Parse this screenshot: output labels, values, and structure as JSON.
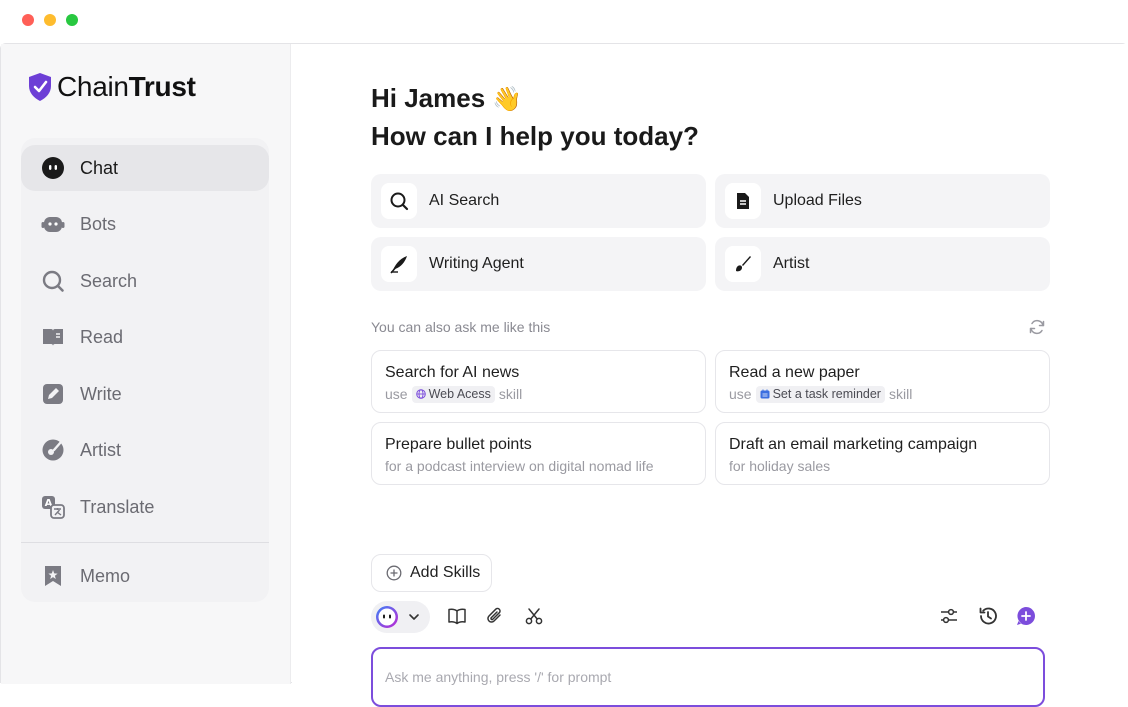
{
  "brand": {
    "part1": "Chain",
    "part2": "Trust"
  },
  "sidebar": {
    "items": [
      {
        "label": "Chat",
        "icon": "chat-bot-icon",
        "active": true
      },
      {
        "label": "Bots",
        "icon": "bots-icon"
      },
      {
        "label": "Search",
        "icon": "search-icon"
      },
      {
        "label": "Read",
        "icon": "read-icon"
      },
      {
        "label": "Write",
        "icon": "write-icon"
      },
      {
        "label": "Artist",
        "icon": "artist-icon"
      },
      {
        "label": "Translate",
        "icon": "translate-icon"
      }
    ],
    "memo": {
      "label": "Memo",
      "icon": "memo-icon"
    }
  },
  "main": {
    "greeting_line1": "Hi James",
    "greeting_emoji": "👋",
    "greeting_line2": "How can I help you today?",
    "actions": [
      {
        "label": "AI Search",
        "icon": "search-icon"
      },
      {
        "label": "Upload Files",
        "icon": "file-icon"
      },
      {
        "label": "Writing Agent",
        "icon": "quill-icon"
      },
      {
        "label": "Artist",
        "icon": "brush-icon"
      }
    ],
    "hint": "You can also ask me like this",
    "suggestions": [
      {
        "title": "Search for AI news",
        "pre": "use",
        "chip": "Web Acess",
        "post": "skill",
        "chip_icon": "globe-icon"
      },
      {
        "title": "Read a new paper",
        "pre": "use",
        "chip": "Set a task reminder",
        "post": "skill",
        "chip_icon": "calendar-icon"
      },
      {
        "title": "Prepare bullet points",
        "sub": "for a podcast interview on digital nomad life"
      },
      {
        "title": "Draft an email marketing campaign",
        "sub": "for holiday sales"
      }
    ],
    "add_skills": "Add Skills",
    "input_placeholder": "Ask me anything, press '/' for prompt"
  },
  "colors": {
    "accent": "#7c4ddc",
    "brand_shield": "#6d3fd6"
  }
}
